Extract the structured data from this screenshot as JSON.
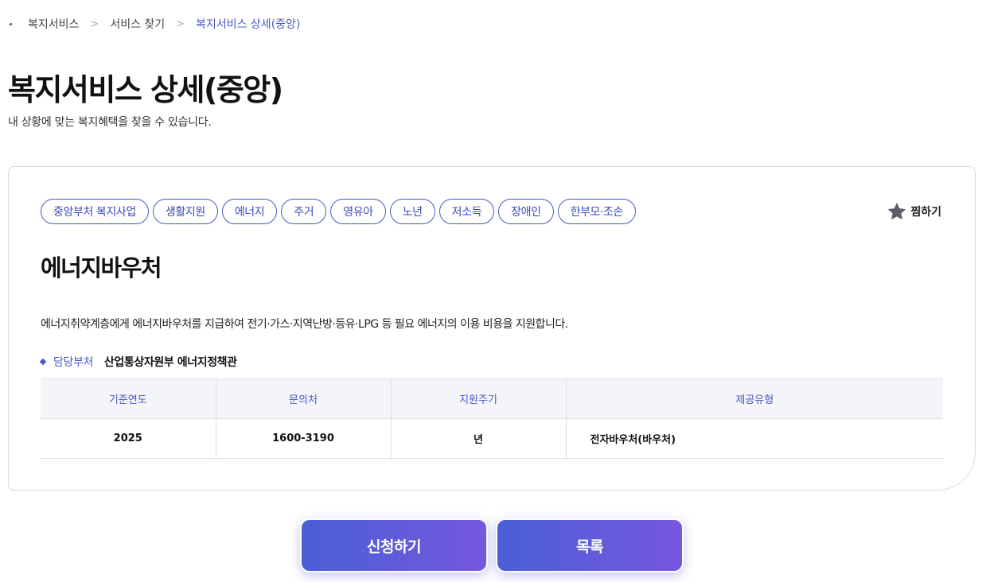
{
  "breadcrumb": [
    "복지서비스",
    "서비스 찾기",
    "복지서비스 상세(중앙)"
  ],
  "page": {
    "title": "복지서비스 상세(중앙)",
    "description": "내 상황에 맞는 복지혜택을 찾을 수 있습니다."
  },
  "tags": [
    "중앙부처 복지사업",
    "생활지원",
    "에너지",
    "주거",
    "영유아",
    "노년",
    "저소득",
    "장애인",
    "한부모·조손"
  ],
  "favorite": {
    "label": "찜하기",
    "icon": "star-icon"
  },
  "service": {
    "title": "에너지바우처",
    "description": "에너지취약계층에게 에너지바우처를 지급하여 전기·가스·지역난방·등유·LPG 등 필요 에너지의 이용 비용을 지원합니다.",
    "dept_label": "담당부처",
    "dept_value": "산업통상자원부 에너지정책관"
  },
  "table": {
    "headers": [
      "기준연도",
      "문의처",
      "지원주기",
      "제공유형"
    ],
    "row": [
      "2025",
      "1600-3190",
      "년",
      "전자바우처(바우처)"
    ]
  },
  "buttons": {
    "apply": "신청하기",
    "list": "목록"
  },
  "colors": {
    "accent": "#4a57c8",
    "button_start": "#4a5fd6",
    "button_end": "#7657e0"
  }
}
